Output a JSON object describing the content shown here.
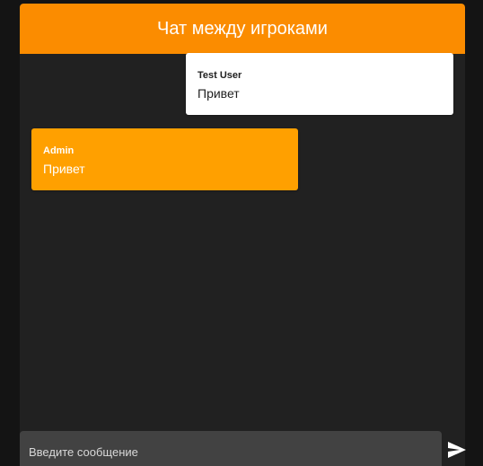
{
  "header": {
    "title": "Чат между игроками"
  },
  "messages": [
    {
      "author": "Test User",
      "text": "Привет",
      "align": "right"
    },
    {
      "author": "Admin",
      "text": "Привет",
      "align": "left"
    }
  ],
  "composer": {
    "placeholder": "Введите сообщение",
    "value": ""
  },
  "icons": {
    "send": "send-icon"
  },
  "colors": {
    "header": "#fb8c00",
    "own_message": "#ffa000",
    "panel": "#212121",
    "page": "#141414"
  }
}
